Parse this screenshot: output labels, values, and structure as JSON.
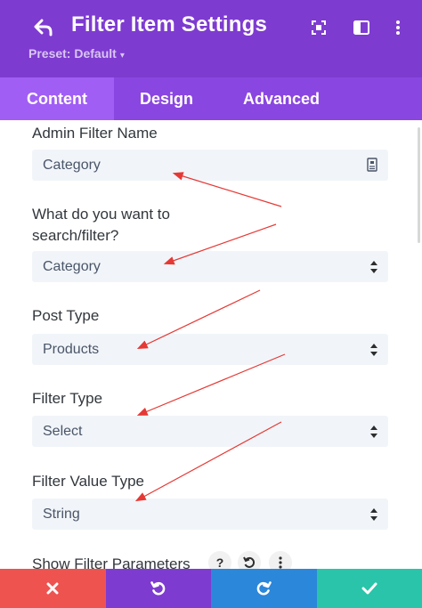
{
  "header": {
    "title": "Filter Item Settings",
    "preset_label": "Preset: Default",
    "icons": [
      "back-arrow-icon",
      "focus-icon",
      "sidebar-layout-icon",
      "more-vertical-icon"
    ],
    "background": "#7e3bd0"
  },
  "tabs": [
    {
      "label": "Content",
      "active": true
    },
    {
      "label": "Design",
      "active": false
    },
    {
      "label": "Advanced",
      "active": false
    }
  ],
  "fields": {
    "admin_filter_name": {
      "label": "Admin Filter Name",
      "value": "Category"
    },
    "search_filter": {
      "label": "What do you want to search/filter?",
      "label_line1": "What do you want to",
      "label_line2": "search/filter?",
      "value": "Category"
    },
    "post_type": {
      "label": "Post Type",
      "value": "Products"
    },
    "filter_type": {
      "label": "Filter Type",
      "value": "Select"
    },
    "filter_value_type": {
      "label": "Filter Value Type",
      "value": "String"
    }
  },
  "show_filter_parameters": {
    "label": "Show Filter Parameters",
    "help_icon": "?"
  },
  "footer": {
    "buttons": [
      {
        "name": "discard",
        "icon": "close-icon",
        "color": "#ef5350"
      },
      {
        "name": "undo",
        "icon": "undo-icon",
        "color": "#7e3bd0"
      },
      {
        "name": "redo",
        "icon": "redo-icon",
        "color": "#2b87da"
      },
      {
        "name": "save",
        "icon": "check-icon",
        "color": "#29c4a9"
      }
    ]
  },
  "colors": {
    "accent": "#7e3bd0",
    "tab_bar": "#8a46e0",
    "active_tab": "#a15ef5",
    "annotation_arrow": "#e53935"
  }
}
